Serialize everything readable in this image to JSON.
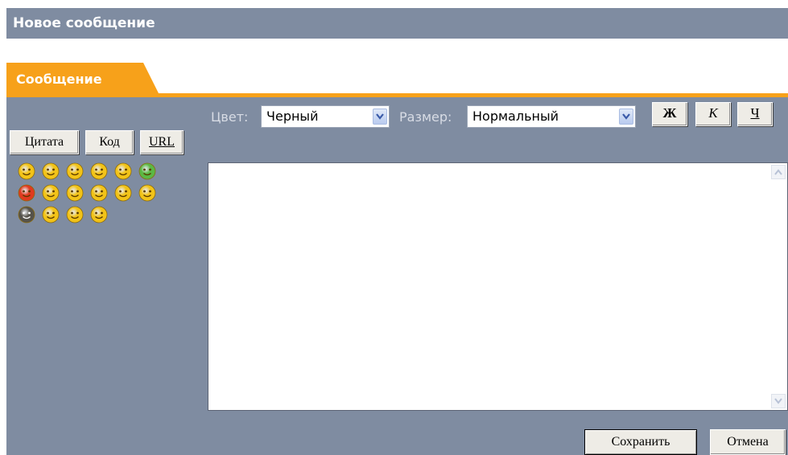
{
  "header": {
    "title": "Новое сообщение"
  },
  "tab": {
    "label": "Сообщение"
  },
  "toolbar": {
    "color_label": "Цвет:",
    "color_value": "Черный",
    "size_label": "Размер:",
    "size_value": "Нормальный",
    "bold_label": "Ж",
    "italic_label": "К",
    "underline_label": "Ч"
  },
  "insert_buttons": {
    "quote": "Цитата",
    "code": "Код",
    "url": "URL"
  },
  "smileys": [
    {
      "name": "cool-smiley-icon",
      "color": "#f2c318"
    },
    {
      "name": "smile-smiley-icon",
      "color": "#f2c318"
    },
    {
      "name": "happy-smiley-icon",
      "color": "#f2c318"
    },
    {
      "name": "grin-smiley-icon",
      "color": "#f2c318"
    },
    {
      "name": "surprised-smiley-icon",
      "color": "#f2c318"
    },
    {
      "name": "sick-smiley-icon",
      "color": "#5bb844"
    },
    {
      "name": "angry-smiley-icon",
      "color": "#e03a1e"
    },
    {
      "name": "rolleyes-smiley-icon",
      "color": "#f2c318"
    },
    {
      "name": "tongue-smiley-icon",
      "color": "#f2c318"
    },
    {
      "name": "sad-smiley-icon",
      "color": "#f2c318"
    },
    {
      "name": "wink-smiley-icon",
      "color": "#f2c318"
    },
    {
      "name": "confused-smiley-icon",
      "color": "#f2c318"
    },
    {
      "name": "nerd-smiley-icon",
      "color": "#55524a"
    },
    {
      "name": "laugh-smiley-icon",
      "color": "#f2c318"
    },
    {
      "name": "unsure-smiley-icon",
      "color": "#f2c318"
    },
    {
      "name": "shocked-smiley-icon",
      "color": "#f2c318"
    }
  ],
  "editor": {
    "value": ""
  },
  "actions": {
    "save": "Сохранить",
    "cancel": "Отмена"
  },
  "colors": {
    "panel": "#7f8ca1",
    "accent": "#f7a11a",
    "button_face": "#eeece6"
  }
}
